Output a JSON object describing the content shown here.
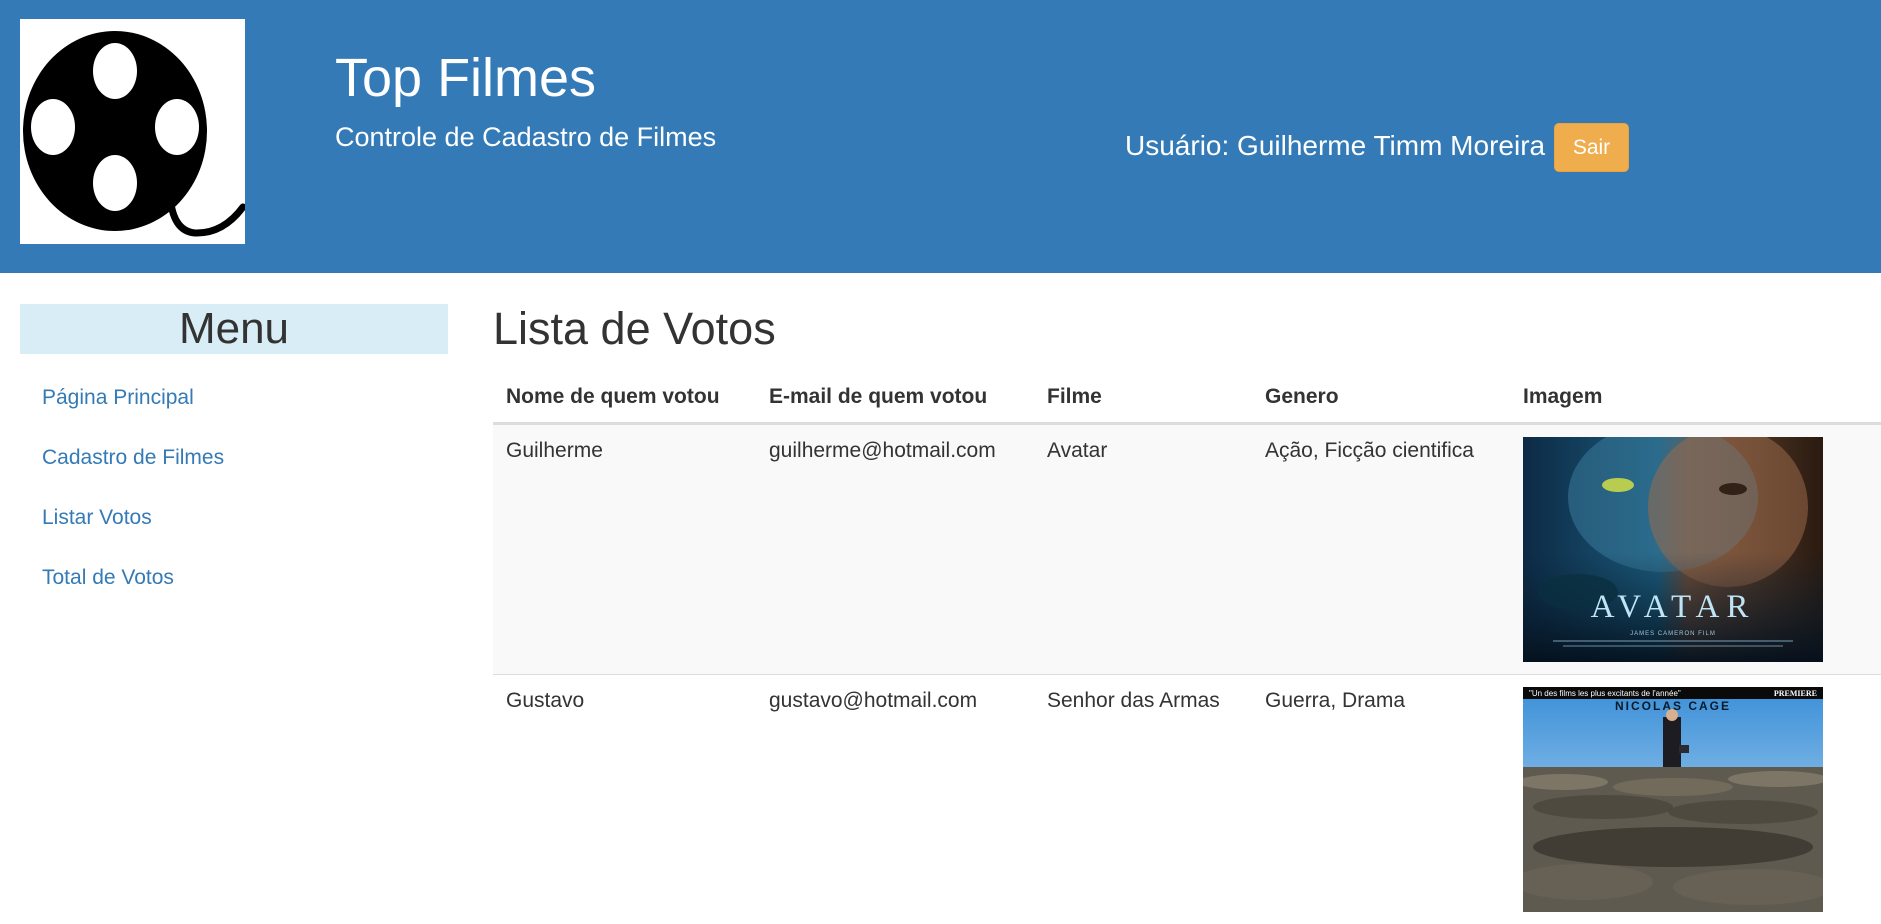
{
  "header": {
    "title": "Top Filmes",
    "subtitle": "Controle de Cadastro de Filmes",
    "user_text": "Usuário: Guilherme Timm Moreira -",
    "logout_label": "Sair",
    "logo_icon": "film-reel-icon"
  },
  "menu": {
    "title": "Menu",
    "items": [
      {
        "label": "Página Principal"
      },
      {
        "label": "Cadastro de Filmes"
      },
      {
        "label": "Listar Votos"
      },
      {
        "label": "Total de Votos"
      }
    ]
  },
  "main": {
    "heading": "Lista de Votos",
    "columns": [
      "Nome de quem votou",
      "E-mail de quem votou",
      "Filme",
      "Genero",
      "Imagem"
    ],
    "rows": [
      {
        "name": "Guilherme",
        "email": "guilherme@hotmail.com",
        "film": "Avatar",
        "genre": "Ação, Ficção cientifica",
        "poster": {
          "title": "AVATAR",
          "small_text": "JAMES CAMERON FILM"
        }
      },
      {
        "name": "Gustavo",
        "email": "gustavo@hotmail.com",
        "film": "Senhor das Armas",
        "genre": "Guerra, Drama",
        "poster": {
          "tagline": "\"Un des films les plus excitants de l'année\"",
          "brand": "PREMIERE",
          "actor": "NICOLAS CAGE"
        }
      }
    ]
  },
  "colors": {
    "header_bg": "#337ab7",
    "menu_title_bg": "#d9edf7",
    "button_warning": "#f0ad4e",
    "link": "#337ab7"
  }
}
